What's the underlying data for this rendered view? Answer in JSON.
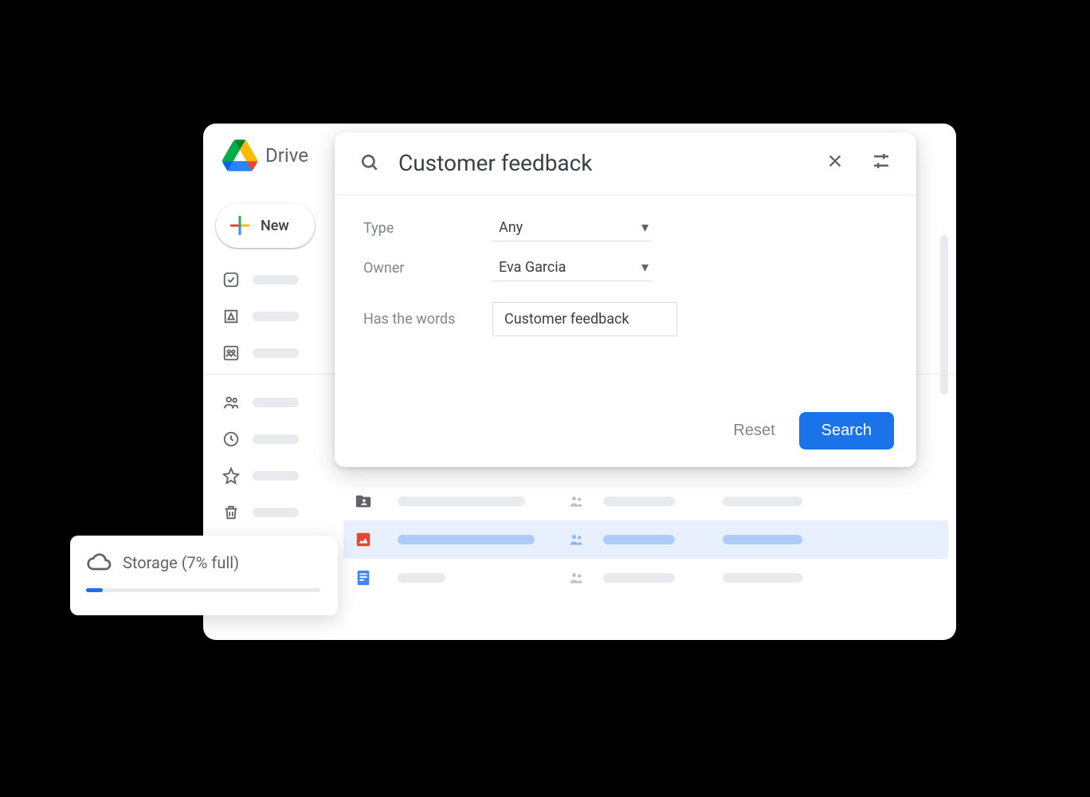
{
  "app": {
    "title": "Drive"
  },
  "new_button": {
    "label": "New"
  },
  "search": {
    "query": "Customer feedback",
    "filters": {
      "type_label": "Type",
      "type_value": "Any",
      "owner_label": "Owner",
      "owner_value": "Eva Garcia",
      "words_label": "Has the words",
      "words_value": "Customer feedback"
    },
    "reset_label": "Reset",
    "search_label": "Search"
  },
  "storage": {
    "label": "Storage (7% full)",
    "percent": 7
  }
}
